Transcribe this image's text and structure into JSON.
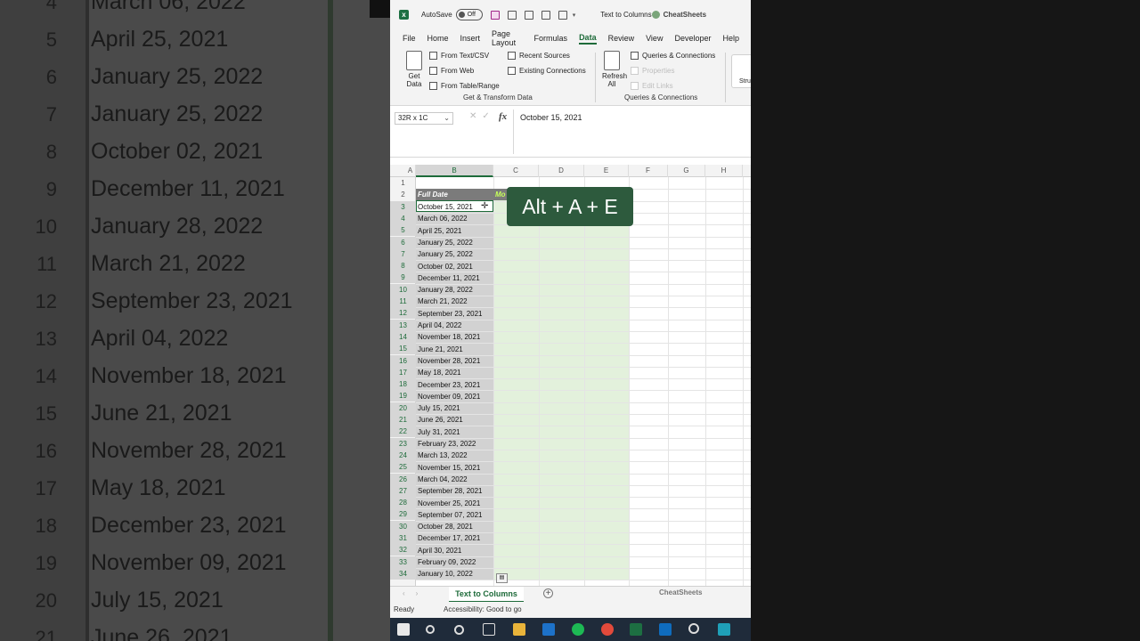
{
  "background": {
    "row_numbers": [
      "4",
      "5",
      "6",
      "7",
      "8",
      "9",
      "10",
      "11",
      "12",
      "13",
      "14",
      "15",
      "16",
      "17",
      "18",
      "19",
      "20",
      "21"
    ],
    "dates": [
      "March 06, 2022",
      "April 25, 2021",
      "January 25, 2022",
      "January 25, 2022",
      "October 02, 2021",
      "December 11, 2021",
      "January 28, 2022",
      "March 21, 2022",
      "September 23, 2021",
      "April 04, 2022",
      "November 18, 2021",
      "June 21, 2021",
      "November 28, 2021",
      "May 18, 2021",
      "December 23, 2021",
      "November 09, 2021",
      "July 15, 2021",
      "June 26, 2021"
    ]
  },
  "titlebar": {
    "autosave_label": "AutoSave",
    "autosave_state": "Off",
    "doc_title": "Text to Columns",
    "brand": "CheatSheets"
  },
  "menu": [
    "File",
    "Home",
    "Insert",
    "Page Layout",
    "Formulas",
    "Data",
    "Review",
    "View",
    "Developer",
    "Help"
  ],
  "menu_active": "Data",
  "ribbon": {
    "get_data_label": "Get",
    "get_data_label2": "Data",
    "from_text": "From Text/CSV",
    "from_web": "From Web",
    "from_table": "From Table/Range",
    "recent_sources": "Recent Sources",
    "existing_connections": "Existing Connections",
    "group1_label": "Get & Transform Data",
    "refresh_label": "Refresh",
    "refresh_label2": "All",
    "queries_connections": "Queries & Connections",
    "properties": "Properties",
    "edit_links": "Edit Links",
    "group2_label": "Queries & Connections",
    "stru_label": "Stru"
  },
  "formula_bar": {
    "name_box": "32R x 1C",
    "fx": "fx",
    "value": "October 15, 2021"
  },
  "columns": [
    "A",
    "B",
    "C",
    "D",
    "E",
    "F",
    "G",
    "H"
  ],
  "rows": [
    "1",
    "2",
    "3",
    "4",
    "5",
    "6",
    "7",
    "8",
    "9",
    "10",
    "11",
    "12",
    "13",
    "14",
    "15",
    "16",
    "17",
    "18",
    "19",
    "20",
    "21",
    "22",
    "23",
    "24",
    "25",
    "26",
    "27",
    "28",
    "29",
    "30",
    "31",
    "32",
    "33",
    "34"
  ],
  "header_cell": "Full Date",
  "header_cell2": "Mo",
  "dates": [
    "October 15, 2021",
    "March 06, 2022",
    "April 25, 2021",
    "January 25, 2022",
    "January 25, 2022",
    "October 02, 2021",
    "December 11, 2021",
    "January 28, 2022",
    "March 21, 2022",
    "September 23, 2021",
    "April 04, 2022",
    "November 18, 2021",
    "June 21, 2021",
    "November 28, 2021",
    "May 18, 2021",
    "December 23, 2021",
    "November 09, 2021",
    "July 15, 2021",
    "June 26, 2021",
    "July 31, 2021",
    "February 23, 2022",
    "March 13, 2022",
    "November 15, 2021",
    "March 04, 2022",
    "September 28, 2021",
    "November 25, 2021",
    "September 07, 2021",
    "October 28, 2021",
    "December 17, 2021",
    "April 30, 2021",
    "February 09, 2022",
    "January 10, 2022"
  ],
  "shortcut": "Alt + A + E",
  "sheet_tab": "Text to Columns",
  "sheet_brand": "CheatSheets",
  "status": {
    "ready": "Ready",
    "accessibility": "Accessibility: Good to go"
  },
  "colors": {
    "accent": "#1e6b3a",
    "shortcut_bg": "#2d5a3d",
    "selection_green": "#e3f1dc"
  }
}
